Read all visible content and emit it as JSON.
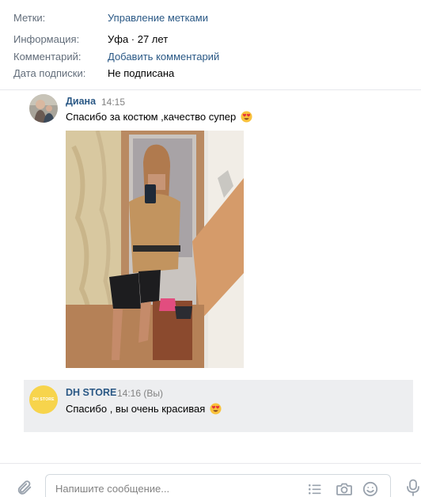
{
  "info": {
    "rows": [
      {
        "label": "Метки:",
        "value": "Управление метками"
      },
      {
        "label": "Информация:",
        "value": "Уфа · 27 лет"
      },
      {
        "label": "Комментарий:",
        "value": "Добавить комментарий"
      },
      {
        "label": "Дата подписки:",
        "value": "Не подписана"
      }
    ]
  },
  "messages": [
    {
      "author": "Диана",
      "time": "14:15",
      "text": "Спасибо за костюм ,качество супер",
      "emoji": "heart-eyes-emoji"
    },
    {
      "author": "DH STORE",
      "time": "14:16 (Вы)",
      "text": "Спасибо , вы очень красивая",
      "emoji": "heart-eyes-emoji",
      "avatar_text": "DH STORE"
    }
  ],
  "composer": {
    "placeholder": "Напишите сообщение..."
  },
  "colors": {
    "link": "#2a5885",
    "muted": "#828282",
    "outgoing_bg": "#edeef0",
    "store_logo": "#f7d44c"
  }
}
